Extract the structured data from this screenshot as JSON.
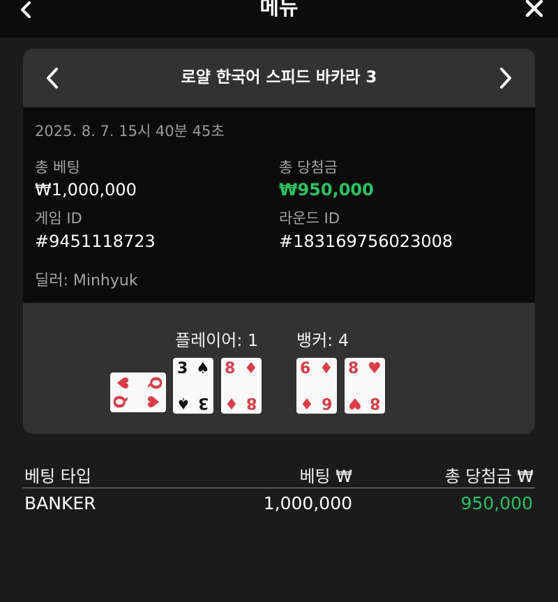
{
  "header": {
    "title": "메뉴"
  },
  "card": {
    "table_name": "로얄 한국어 스피드 바카라 3",
    "datetime": "2025. 8. 7. 15시 40분 45초",
    "total_bet_label": "총 베팅",
    "total_bet_value": "₩1,000,000",
    "total_win_label": "총 당첨금",
    "total_win_value": "₩950,000",
    "game_id_label": "게임 ID",
    "game_id_value": "#9451118723",
    "round_id_label": "라운드 ID",
    "round_id_value": "#183169756023008",
    "dealer": "딜러: Minhyuk"
  },
  "result": {
    "player_score": "플레이어: 1",
    "banker_score": "뱅커: 4",
    "player_cards": [
      {
        "rank": "Q",
        "suit": "♥",
        "color": "red",
        "orientation": "sideways"
      },
      {
        "rank": "3",
        "suit": "♠",
        "color": "black"
      },
      {
        "rank": "8",
        "suit": "♦",
        "color": "red"
      }
    ],
    "banker_cards": [
      {
        "rank": "6",
        "suit": "♦",
        "color": "red"
      },
      {
        "rank": "8",
        "suit": "♥",
        "color": "red"
      }
    ]
  },
  "bets": {
    "columns": [
      "베팅 타입",
      "베팅 ₩",
      "총 당첨금 ₩"
    ],
    "rows": [
      {
        "type": "BANKER",
        "bet": "1,000,000",
        "win": "950,000"
      }
    ]
  },
  "colors": {
    "background": "#1b1b1b",
    "card": "#323232",
    "info_panel": "#0b0b0b",
    "win_green": "#22c55e",
    "card_red": "#e03a45"
  }
}
